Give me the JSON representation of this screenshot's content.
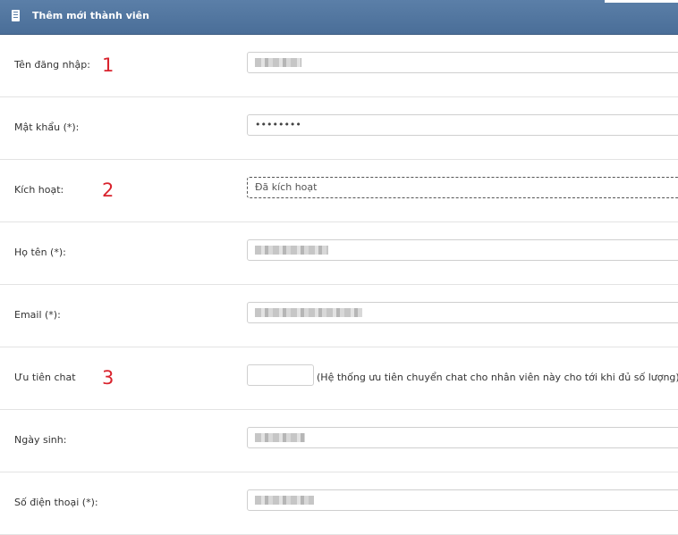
{
  "header": {
    "title": "Thêm mới thành viên",
    "icon": "document-icon"
  },
  "markers": {
    "m1": "1",
    "m2": "2",
    "m3": "3"
  },
  "form": {
    "username": {
      "label": "Tên đăng nhập:"
    },
    "password": {
      "label": "Mật khẩu (*):",
      "value": "••••••••"
    },
    "active": {
      "label": "Kích hoạt:",
      "value": "Đã kích hoạt"
    },
    "fullname": {
      "label": "Họ tên (*):"
    },
    "email": {
      "label": "Email (*):"
    },
    "chat_priority": {
      "label": "Ưu tiên chat",
      "hint": "(Hệ thống ưu tiên chuyển chat cho nhân viên này cho tới khi đủ số lượng)"
    },
    "birthday": {
      "label": "Ngày sinh:"
    },
    "phone": {
      "label": "Số điện thoại (*):"
    }
  }
}
